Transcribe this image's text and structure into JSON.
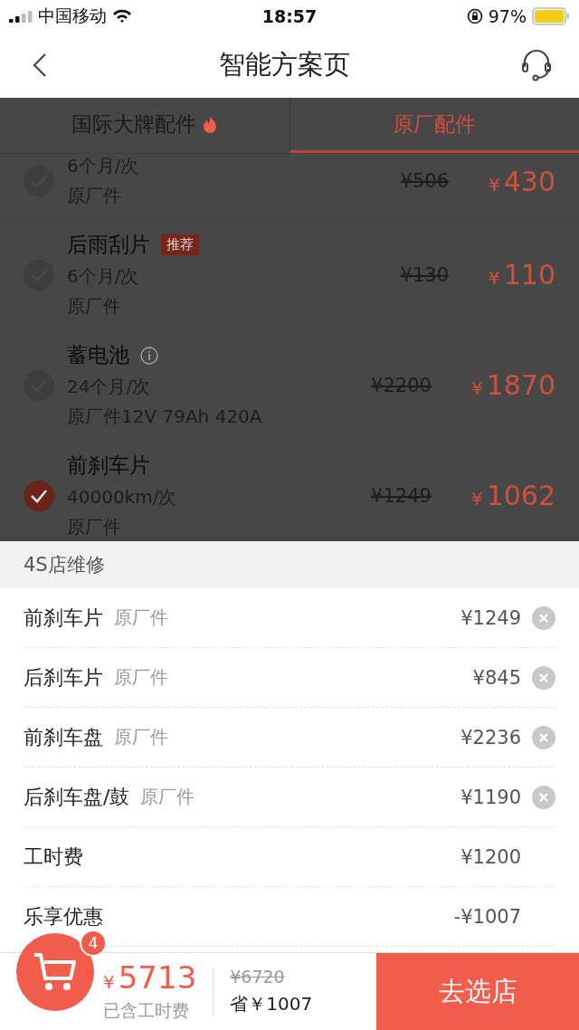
{
  "status_bar": {
    "carrier": "中国移动",
    "time": "18:57",
    "battery": "97%"
  },
  "nav": {
    "title": "智能方案页"
  },
  "tabs": [
    {
      "label": "国际大牌配件",
      "hot": true,
      "selected": false
    },
    {
      "label": "原厂配件",
      "hot": false,
      "selected": true
    }
  ],
  "items": [
    {
      "checked": false,
      "cycle": "6个月/次",
      "spec": "原厂件",
      "old_price": "¥506",
      "price": "430"
    },
    {
      "name": "后雨刮片",
      "badge": "推荐",
      "checked": false,
      "cycle": "6个月/次",
      "spec": "原厂件",
      "old_price": "¥130",
      "price": "110"
    },
    {
      "name": "蓄电池",
      "info": true,
      "checked": false,
      "cycle": "24个月/次",
      "spec": "原厂件12V 79Ah 420A",
      "old_price": "¥2200",
      "price": "1870"
    },
    {
      "name": "前刹车片",
      "checked": true,
      "cycle": "40000km/次",
      "spec": "原厂件",
      "old_price": "¥1249",
      "price": "1062"
    }
  ],
  "sheet": {
    "title": "4S店维修",
    "rows": [
      {
        "name": "前刹车片",
        "tag": "原厂件",
        "price": "¥1249",
        "removable": true
      },
      {
        "name": "后刹车片",
        "tag": "原厂件",
        "price": "¥845",
        "removable": true
      },
      {
        "name": "前刹车盘",
        "tag": "原厂件",
        "price": "¥2236",
        "removable": true
      },
      {
        "name": "后刹车盘/鼓",
        "tag": "原厂件",
        "price": "¥1190",
        "removable": true
      },
      {
        "name": "工时费",
        "price": "¥1200",
        "removable": false
      },
      {
        "name": "乐享优惠",
        "price": "-¥1007",
        "removable": false
      }
    ]
  },
  "footer": {
    "cart_count": "4",
    "currency": "¥",
    "total": "5713",
    "total_note": "已含工时费",
    "original": "¥6720",
    "saving": "省￥1007",
    "button": "去选店"
  }
}
